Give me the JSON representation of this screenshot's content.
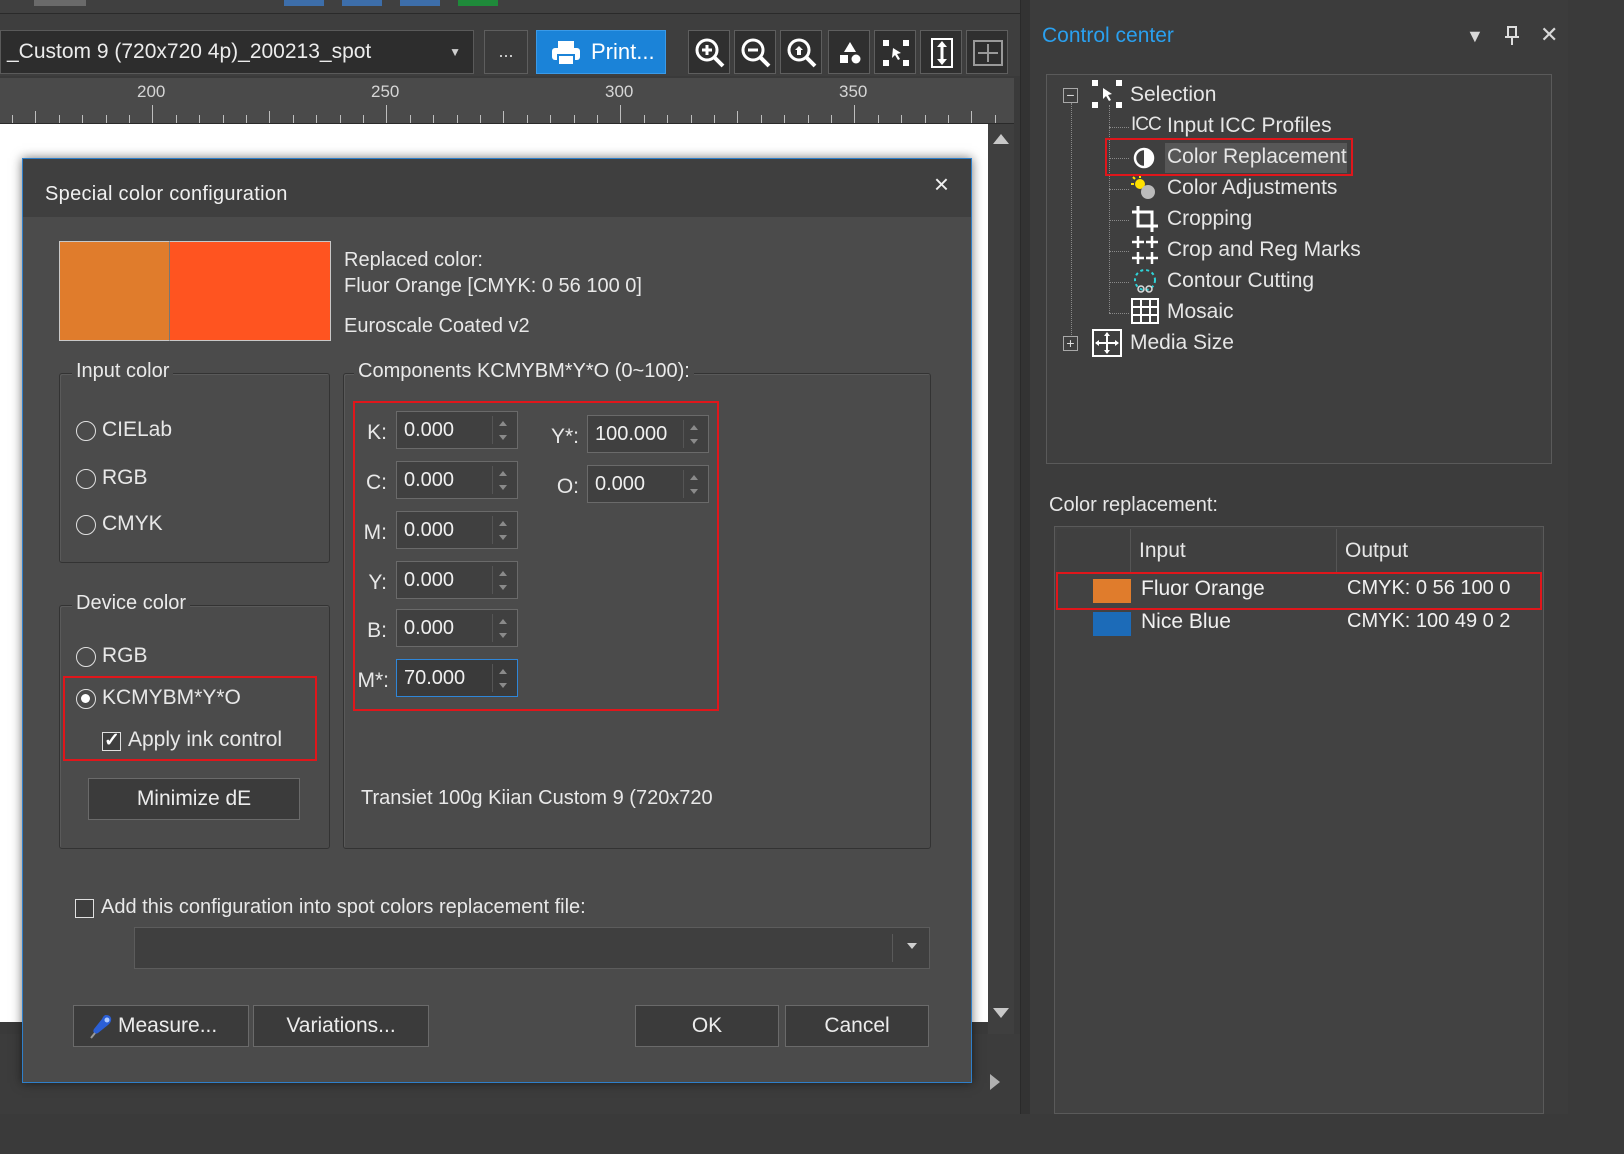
{
  "toolbar": {
    "profile_value": "_Custom 9 (720x720 4p)_200213_spot",
    "more_label": "...",
    "print_label": "Print..."
  },
  "ruler": {
    "labels": [
      "200",
      "250",
      "300",
      "350"
    ]
  },
  "dialog": {
    "title": "Special color configuration",
    "close_glyph": "×",
    "replaced_color_label": "Replaced color:",
    "replaced_color_value": "Fluor Orange  [CMYK: 0 56 100 0]",
    "profile_name": "Euroscale Coated v2",
    "swatch_left_color": "#e07c2c",
    "swatch_right_color": "#ff5420",
    "input_color": {
      "legend": "Input color",
      "options": [
        "CIELab",
        "RGB",
        "CMYK"
      ]
    },
    "device_color": {
      "legend": "Device color",
      "options": [
        "RGB",
        "KCMYBM*Y*O"
      ],
      "selected": "KCMYBM*Y*O",
      "apply_ink_control_label": "Apply ink control",
      "apply_ink_control_checked": true,
      "minimize_label": "Minimize dE"
    },
    "components": {
      "legend": "Components KCMYBM*Y*O (0~100):",
      "K_label": "K:",
      "K_value": "0.000",
      "C_label": "C:",
      "C_value": "0.000",
      "M_label": "M:",
      "M_value": "0.000",
      "Y_label": "Y:",
      "Y_value": "0.000",
      "B_label": "B:",
      "B_value": "0.000",
      "Mstar_label": "M*:",
      "Mstar_value": "70.000",
      "Ystar_label": "Y*:",
      "Ystar_value": "100.000",
      "O_label": "O:",
      "O_value": "0.000",
      "profile_footer": "Transiet  100g  Kiian  Custom 9 (720x720"
    },
    "add_config_label": "Add this configuration into spot colors replacement file:",
    "add_config_checked": false,
    "spot_file_value": "",
    "measure_label": "Measure...",
    "variations_label": "Variations...",
    "ok_label": "OK",
    "cancel_label": "Cancel"
  },
  "control_center": {
    "title": "Control center",
    "tree": {
      "root": "Selection",
      "items": [
        "Input ICC Profiles",
        "Color Replacement",
        "Color Adjustments",
        "Cropping",
        "Crop and Reg Marks",
        "Contour Cutting",
        "Mosaic"
      ],
      "sibling": "Media Size",
      "selected": "Color Replacement",
      "icc_glyph": "ICC"
    },
    "color_replacement_label": "Color replacement:",
    "table": {
      "headers": [
        "Input",
        "Output"
      ],
      "rows": [
        {
          "input": "Fluor Orange",
          "output": "CMYK: 0 56 100 0",
          "color": "#e07c2c"
        },
        {
          "input": "Nice Blue",
          "output": "CMYK: 100 49 0 2",
          "color": "#1c6bb8"
        }
      ]
    }
  }
}
